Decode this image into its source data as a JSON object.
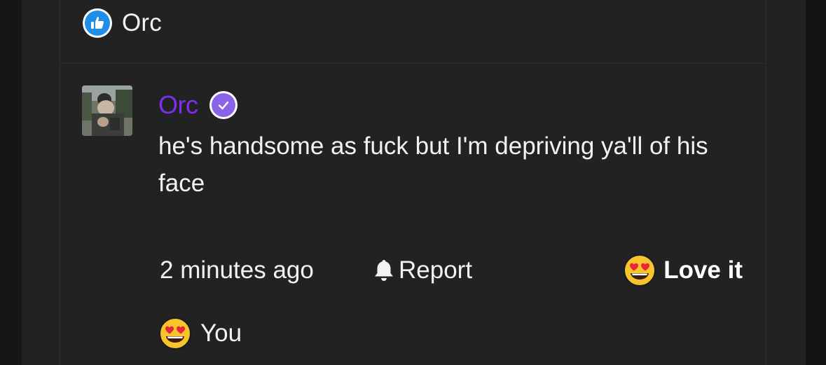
{
  "top_reaction": {
    "icon": "thumbs-up-icon",
    "name": "Orc",
    "icon_color": "#1e8ee8"
  },
  "comment": {
    "author": "Orc",
    "author_color": "#7e2cf0",
    "verified_icon": "verified-check-icon",
    "text": "he's handsome as fuck but I'm depriving ya'll of his face",
    "timestamp": "2 minutes ago",
    "report_label": "Report",
    "report_icon": "bell-icon",
    "love_label": "Love it",
    "love_icon": "heart-eyes-emoji-icon"
  },
  "bottom_reaction": {
    "icon": "heart-eyes-emoji-icon",
    "label": "You"
  }
}
